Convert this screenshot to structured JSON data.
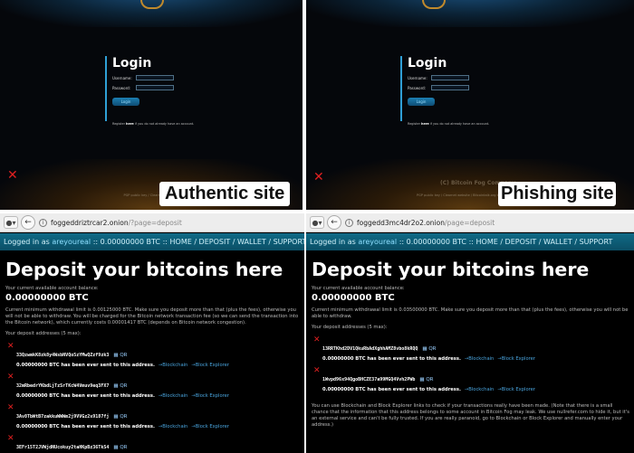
{
  "top_left": {
    "login_title": "Login",
    "username_label": "Username:",
    "password_label": "Password:",
    "login_button": "Login",
    "register_pre": "Register ",
    "register_link": "here",
    "register_post": " if you do not already have an account.",
    "footer": "PGP public key / Clearnet website / ",
    "badge": "Authentic site"
  },
  "top_right": {
    "login_title": "Login",
    "username_label": "Username:",
    "password_label": "Password:",
    "login_button": "Login",
    "register_pre": "Register ",
    "register_link": "here",
    "register_post": " if you do not already have an account.",
    "copyright": "(C) Bitcoin Fog Company",
    "footer": "PGP public key / Clearnet website / Bitcointalk.org t",
    "badge": "Phishing site"
  },
  "bottom_left": {
    "url_host": "foggeddriztrcar2.onion",
    "url_path": "/?page=deposit",
    "nav": {
      "logged_in_as": "Logged in as ",
      "username": "areyoureal",
      "balance": " :: 0.00000000 BTC",
      "links": " :: HOME / DEPOSIT / WALLET / SUPPORT"
    },
    "heading": "Deposit your bitcoins here",
    "balance_label": "Your current available account balance:",
    "balance_value": "0.00000000 BTC",
    "notice": "Current minimum withdrawal limit is 0.00125000 BTC. Make sure you deposit more than that (plus the fees), otherwise you will not be able to withdraw. You will be charged for the Bitcoin network transaction fee (so we can send the transaction into the Bitcoin network), which currently costs 0.00001417 BTC (depends on Bitcoin network congestion).",
    "addresses_label": "Your deposit addresses (5 max):",
    "addresses": [
      {
        "address": "33QzwmkK8zk8y4WsbNVQo5zYMwQZzf9zk3"
      },
      {
        "address": "32mRbedrYKbdLjTzSrTKcW4Vmuv9eq3FX7"
      },
      {
        "address": "3Av8TbWtB7zakkuWWWm2j9VVGz2s9187fj"
      },
      {
        "address": "3EFr15T2JVWjdNUcokuy2taHKpBz36TkS4"
      }
    ],
    "sent_text": "0.00000000 BTC has been ever sent to this address.",
    "qr_label": "QR",
    "blockchain_link": "→Blockchain",
    "explorer_link": "→Block Explorer"
  },
  "bottom_right": {
    "url_host": "foggedd3mc4dr2o2.onion",
    "url_path": "/page=deposit",
    "nav": {
      "logged_in_as": "Logged in as ",
      "username": "areyoureal",
      "balance": " :: 0.00000000 BTC",
      "links": " :: HOME / DEPOSIT / WALLET / SUPPORT"
    },
    "heading": "Deposit your bitcoins here",
    "balance_label": "Your current available account balance:",
    "balance_value": "0.00000000 BTC",
    "notice": "Current minimum withdrawal limit is 0.03500000 BTC. Make sure you deposit more than that (plus the fees), otherwise you will not be able to withdraw.",
    "addresses_label": "Your deposit addresses (5 max):",
    "addresses": [
      {
        "address": "13RRTKhd2DV1QkuRbAdXghhAMZ8vbo8kRQQ"
      },
      {
        "address": "1Wvpd96x94QgoBHCZE37a99MGQ4Vvh2PWb"
      }
    ],
    "sent_text": "0.00000000 BTC has been ever sent to this address.",
    "qr_label": "QR",
    "blockchain_link": "→Blockchain",
    "explorer_link": "→Block Explorer",
    "info_text": "You can use Blockchain and Block Explorer links to check if your transactions really have been made. (Note that there is a small chance that the information that this address belongs to some account in Bitcoin Fog may leak. We use nullrefer.com to hide it, but it's an external service and can't be fully trusted. If you are really paranoid, go to Blockchain or Block Explorer and manually enter your address.)"
  }
}
